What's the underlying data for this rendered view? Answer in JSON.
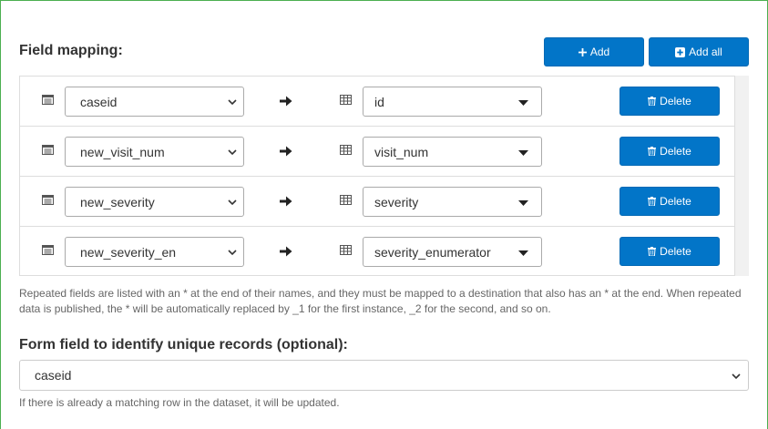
{
  "field_mapping": {
    "title": "Field mapping:",
    "add_label": "Add",
    "add_all_label": "Add all",
    "delete_label": "Delete",
    "rows": [
      {
        "source": "caseid",
        "destination": "id"
      },
      {
        "source": "new_visit_num",
        "destination": "visit_num"
      },
      {
        "source": "new_severity",
        "destination": "severity"
      },
      {
        "source": "new_severity_en",
        "destination": "severity_enumerator"
      }
    ],
    "hint": "Repeated fields are listed with an * at the end of their names, and they must be mapped to a destination that also has an * at the end. When repeated data is published, the * will be automatically replaced by _1 for the first instance, _2 for the second, and so on."
  },
  "unique_records": {
    "title": "Form field to identify unique records (optional):",
    "value": "caseid",
    "hint": "If there is already a matching row in the dataset, it will be updated."
  },
  "colors": {
    "primary": "#0275c8",
    "frame_border": "#4caf50"
  },
  "icons": {
    "add": "plus-icon",
    "add_all": "plus-square-icon",
    "delete": "trash-icon",
    "source": "list-icon",
    "destination": "table-icon",
    "arrow": "arrow-right-icon"
  }
}
